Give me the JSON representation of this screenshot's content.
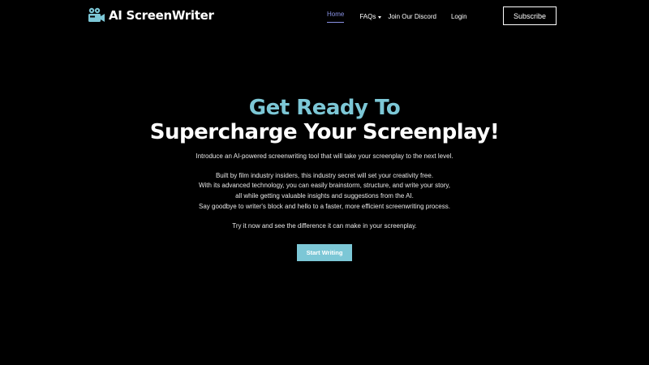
{
  "brand": {
    "name": "AI ScreenWriter",
    "icon": "film-camera-icon",
    "accent_color": "#7cc7d6"
  },
  "nav": {
    "items": [
      {
        "label": "Home",
        "active": true
      },
      {
        "label": "FAQs",
        "has_dropdown": true
      },
      {
        "label": "Join Our Discord"
      },
      {
        "label": "Login"
      }
    ],
    "active_color": "#8a93e6",
    "subscribe_label": "Subscribe"
  },
  "hero": {
    "headline_line1": "Get Ready To",
    "headline_line2": "Supercharge Your Screenplay!",
    "intro": "Introduce an AI-powered screenwriting tool that will take your screenplay to the next level.",
    "body_lines": [
      "Built by film industry insiders, this industry secret will set your creativity free.",
      "With its advanced technology, you can easily brainstorm, structure, and write your story,",
      "all while getting valuable insights and suggestions from the AI.",
      "Say goodbye to writer's block and hello to a faster, more efficient screenwriting process."
    ],
    "try_line": "Try it now and see the difference it can make in your screenplay.",
    "cta_label": "Start Writing"
  }
}
